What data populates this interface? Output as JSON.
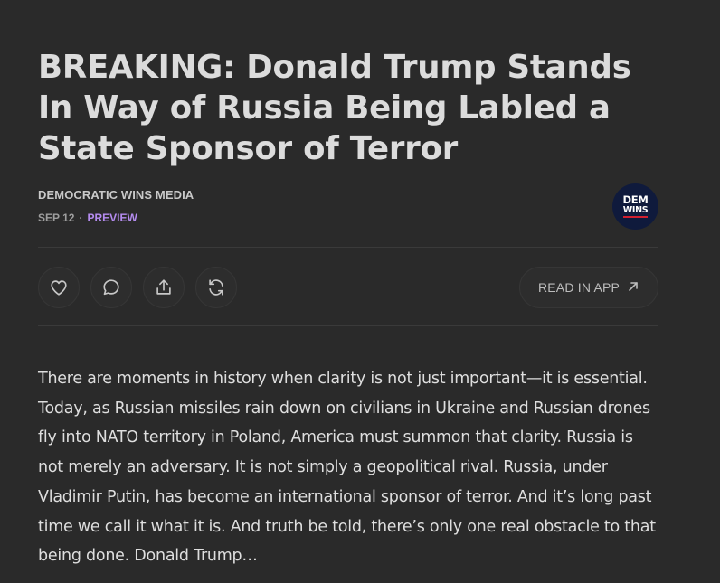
{
  "post": {
    "title": "BREAKING: Donald Trump Stands In Way of Russia Being Labled a State Sponsor of Terror",
    "publication": "DEMOCRATIC WINS MEDIA",
    "date": "SEP 12",
    "separator": "·",
    "access": "PREVIEW",
    "avatar": {
      "line1": "DEM",
      "line2": "WINS"
    },
    "body": "There are moments in history when clarity is not just important—it is essential. Today, as Russian missiles rain down on civilians in Ukraine and Russian drones fly into NATO territory in Poland, America must summon that clarity. Russia is not merely an adversary. It is not simply a geopolitical rival. Russia, under Vladimir Putin, has become an international sponsor of terror. And it’s long past time we call it what it is. And truth be told, there’s only one real obstacle to that being done. Donald Trump…"
  },
  "actions": {
    "like_icon": "heart-icon",
    "comment_icon": "comment-bubble-icon",
    "share_icon": "share-upload-icon",
    "restack_icon": "restack-refresh-icon",
    "read_in_app_label": "READ IN APP",
    "read_in_app_icon": "arrow-up-right-icon"
  },
  "colors": {
    "background": "#2a2a2a",
    "title": "#dcdcdc",
    "preview_accent": "#b58cf0",
    "avatar_bg": "#0f1a3c",
    "avatar_stripe": "#d22030"
  }
}
